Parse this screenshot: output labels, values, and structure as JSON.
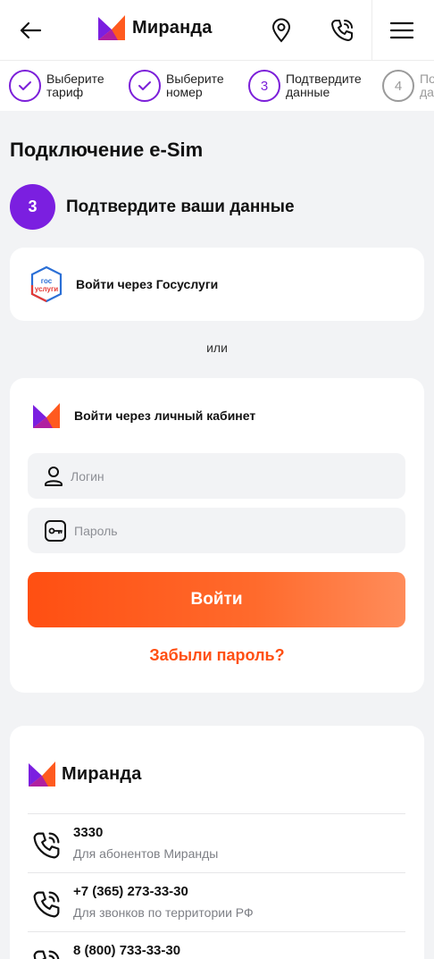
{
  "brand": {
    "name": "Миранда",
    "accent_purple": "#7b1fe0",
    "accent_orange": "#ff4f12"
  },
  "header": {
    "back_icon": "arrow-left-icon",
    "location_icon": "map-pin-icon",
    "phone_icon": "phone-call-icon",
    "menu_icon": "hamburger-menu-icon"
  },
  "steps": [
    {
      "label": "Выберите\nтариф",
      "state": "done"
    },
    {
      "label": "Выберите\nномер",
      "state": "done"
    },
    {
      "number": "3",
      "label": "Подтвердите\nданные",
      "state": "active"
    },
    {
      "number": "4",
      "label": "По\nда",
      "state": "future"
    }
  ],
  "page": {
    "title": "Подключение e-Sim",
    "section_number": "3",
    "section_title": "Подтвердите ваши данные"
  },
  "gosuslugi": {
    "label": "Войти через Госуслуги",
    "logo_top": "гос",
    "logo_bottom": "услуги"
  },
  "or_text": "или",
  "login": {
    "title": "Войти через личный кабинет",
    "login_placeholder": "Логин",
    "password_placeholder": "Пароль",
    "submit_label": "Войти",
    "forgot_label": "Забыли пароль?"
  },
  "footer": {
    "brand": "Миранда",
    "contacts": [
      {
        "number": "3330",
        "description": "Для абонентов Миранды"
      },
      {
        "number": "+7 (365) 273-33-30",
        "description": "Для звонков по территории РФ"
      },
      {
        "number": "8 (800) 733-33-30",
        "description": ""
      }
    ]
  }
}
